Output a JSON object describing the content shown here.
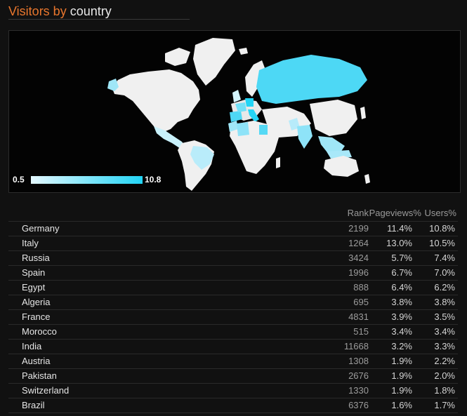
{
  "header": {
    "title_accent": "Visitors by",
    "title_rest": " country"
  },
  "map": {
    "legend_min": "0.5",
    "legend_max": "10.8",
    "colors": {
      "background": "#030303",
      "land_default": "#f0f0f0",
      "low": "#e4f8ff",
      "high": "#22d4f5"
    }
  },
  "table": {
    "headers": {
      "rank": "Rank",
      "pageviews": "Pageviews%",
      "users": "Users%"
    },
    "rows": [
      {
        "country": "Germany",
        "rank": "2199",
        "pageviews": "11.4%",
        "users": "10.8%"
      },
      {
        "country": "Italy",
        "rank": "1264",
        "pageviews": "13.0%",
        "users": "10.5%"
      },
      {
        "country": "Russia",
        "rank": "3424",
        "pageviews": "5.7%",
        "users": "7.4%"
      },
      {
        "country": "Spain",
        "rank": "1996",
        "pageviews": "6.7%",
        "users": "7.0%"
      },
      {
        "country": "Egypt",
        "rank": "888",
        "pageviews": "6.4%",
        "users": "6.2%"
      },
      {
        "country": "Algeria",
        "rank": "695",
        "pageviews": "3.8%",
        "users": "3.8%"
      },
      {
        "country": "France",
        "rank": "4831",
        "pageviews": "3.9%",
        "users": "3.5%"
      },
      {
        "country": "Morocco",
        "rank": "515",
        "pageviews": "3.4%",
        "users": "3.4%"
      },
      {
        "country": "India",
        "rank": "11668",
        "pageviews": "3.2%",
        "users": "3.3%"
      },
      {
        "country": "Austria",
        "rank": "1308",
        "pageviews": "1.9%",
        "users": "2.2%"
      },
      {
        "country": "Pakistan",
        "rank": "2676",
        "pageviews": "1.9%",
        "users": "2.0%"
      },
      {
        "country": "Switzerland",
        "rank": "1330",
        "pageviews": "1.9%",
        "users": "1.8%"
      },
      {
        "country": "Brazil",
        "rank": "6376",
        "pageviews": "1.6%",
        "users": "1.7%"
      }
    ]
  }
}
